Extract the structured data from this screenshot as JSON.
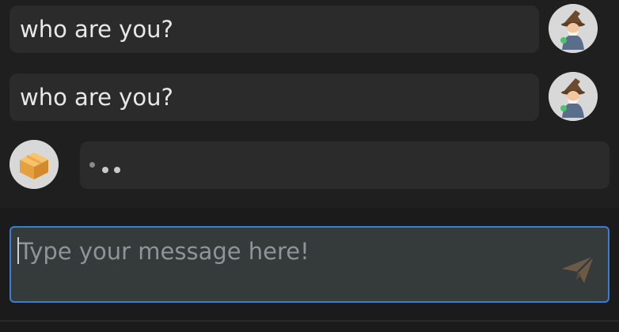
{
  "messages": [
    {
      "role": "user",
      "text": "who are you?",
      "avatar_icon": "wizard-avatar-icon"
    },
    {
      "role": "user",
      "text": "who are you?",
      "avatar_icon": "wizard-avatar-icon"
    },
    {
      "role": "assistant",
      "status": "typing",
      "avatar_icon": "box-avatar-icon"
    }
  ],
  "composer": {
    "placeholder": "Type your message here!",
    "value": "",
    "send_icon": "paper-plane-icon"
  },
  "colors": {
    "background": "#1f1f1f",
    "bubble": "#2b2b2b",
    "composer_bg": "#353a3b",
    "composer_border": "#3f7bd1",
    "send_icon": "#6b5a45"
  }
}
